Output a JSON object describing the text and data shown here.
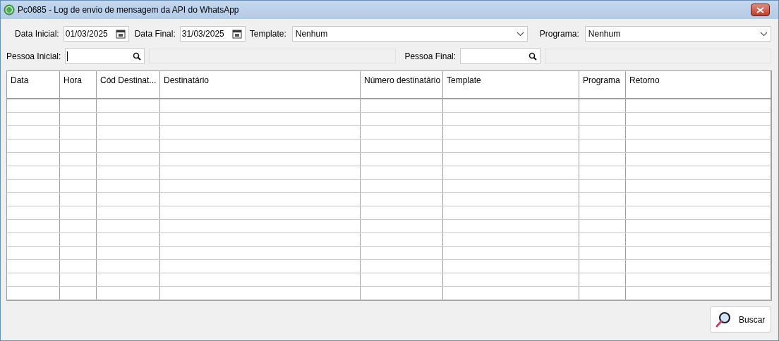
{
  "window": {
    "title": "Pc0685 - Log de envio de mensagem da API do WhatsApp"
  },
  "filters": {
    "data_inicial": {
      "label": "Data Inicial:",
      "value": "01/03/2025"
    },
    "data_final": {
      "label": "Data Final:",
      "value": "31/03/2025"
    },
    "template": {
      "label": "Template:",
      "value": "Nenhum"
    },
    "programa": {
      "label": "Programa:",
      "value": "Nenhum"
    },
    "pessoa_inicial": {
      "label": "Pessoa Inicial:"
    },
    "pessoa_final": {
      "label": "Pessoa Final:"
    }
  },
  "table": {
    "columns": [
      "Data",
      "Hora",
      "Cód Destinat...",
      "Destinatário",
      "Número destinatário",
      "Template",
      "Programa",
      "Retorno"
    ]
  },
  "buttons": [
    {
      "label": "Buscar"
    }
  ]
}
